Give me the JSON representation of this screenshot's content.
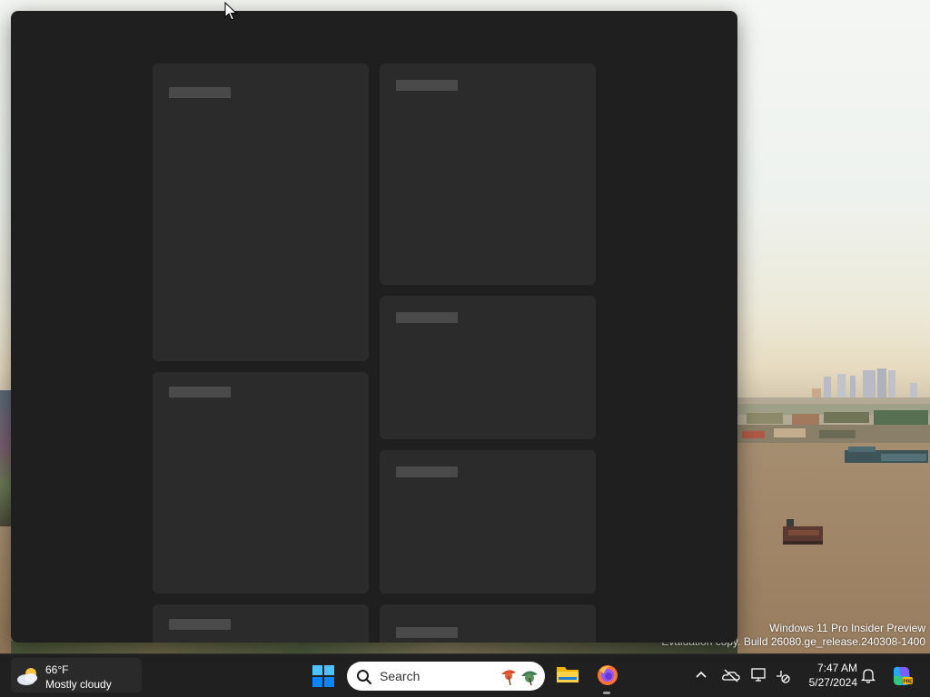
{
  "desktop": {
    "watermark_line1": "Windows 11 Pro Insider Preview",
    "watermark_line2": "Evaluation copy. Build 26080.ge_release.240308-1400"
  },
  "widgets_board": {
    "cards": [
      {
        "id": "card-1",
        "state": "loading"
      },
      {
        "id": "card-2",
        "state": "loading"
      },
      {
        "id": "card-3",
        "state": "loading"
      },
      {
        "id": "card-4",
        "state": "loading"
      },
      {
        "id": "card-5",
        "state": "loading"
      },
      {
        "id": "card-6",
        "state": "loading"
      },
      {
        "id": "card-7",
        "state": "loading"
      }
    ],
    "background_color": "#1f1f1f",
    "card_color": "#2b2b2b",
    "placeholder_color": "#4a4a4a"
  },
  "taskbar": {
    "weather": {
      "temperature": "66°F",
      "condition": "Mostly cloudy",
      "icon": "partly-cloudy-icon"
    },
    "start_icon": "windows-logo-icon",
    "search": {
      "label": "Search"
    },
    "pinned_apps": [
      {
        "name": "File Explorer",
        "icon": "folder-icon"
      },
      {
        "name": "Firefox",
        "icon": "firefox-icon",
        "running": true
      }
    ],
    "tray": {
      "icons": [
        "chevron-up-icon",
        "onedrive-icon",
        "display-icon",
        "network-icon",
        "bell-icon",
        "copilot-icon"
      ],
      "time": "7:47 AM",
      "date": "5/27/2024"
    },
    "accent_color": "#0a84ff"
  }
}
